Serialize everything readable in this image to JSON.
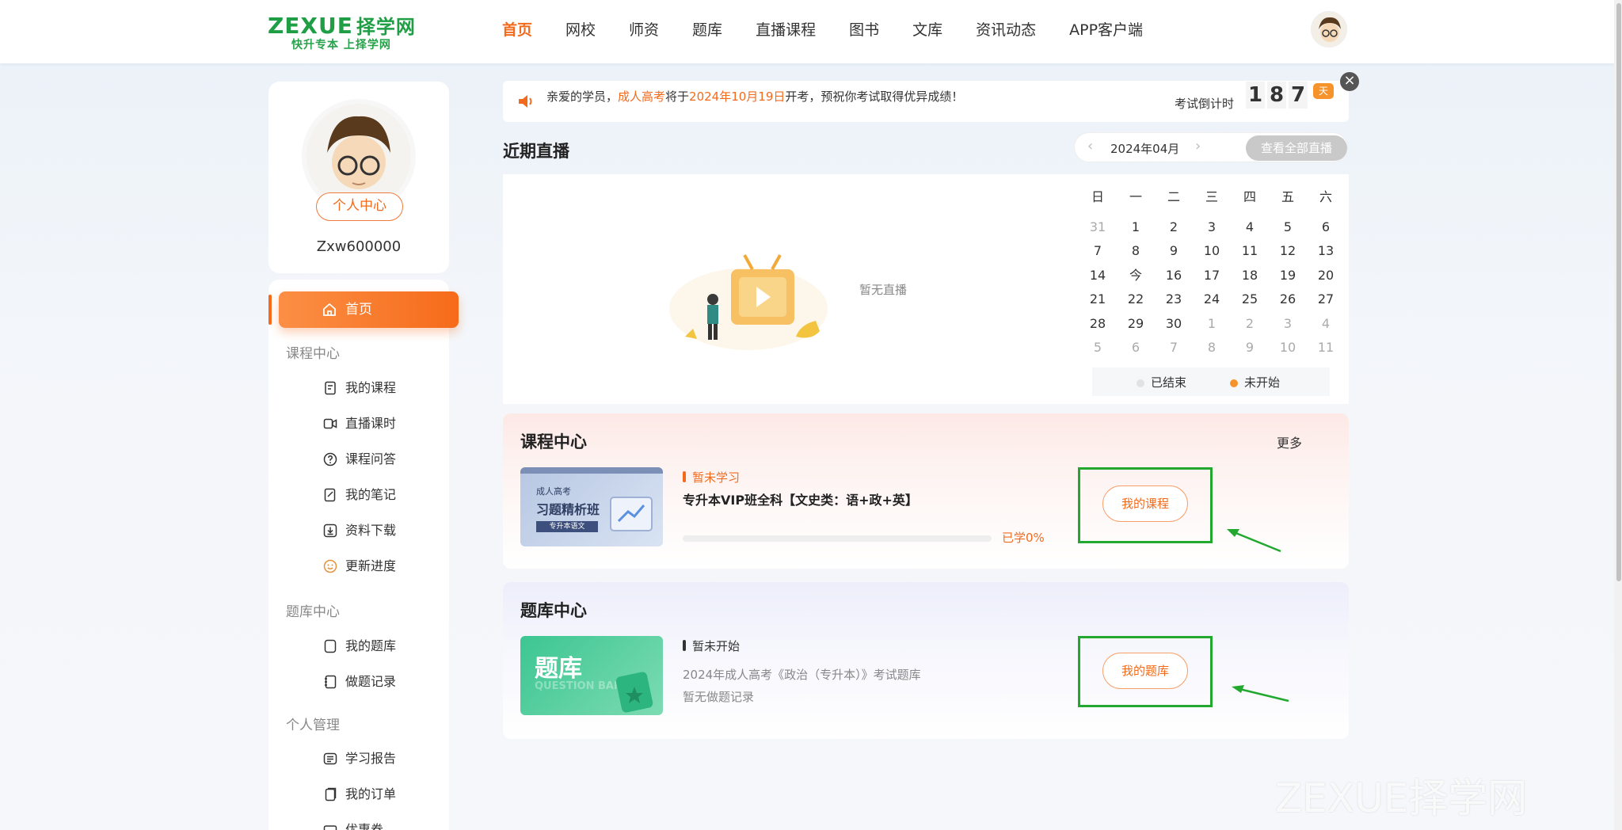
{
  "logo": {
    "brand": "ZEXUE",
    "brand_cn": "择学网",
    "slogan": "快升专本 上择学网"
  },
  "nav": [
    {
      "label": "首页",
      "active": true
    },
    {
      "label": "网校"
    },
    {
      "label": "师资"
    },
    {
      "label": "题库"
    },
    {
      "label": "直播课程"
    },
    {
      "label": "图书"
    },
    {
      "label": "文库"
    },
    {
      "label": "资讯动态"
    },
    {
      "label": "APP客户端"
    }
  ],
  "profile": {
    "center_label": "个人中心",
    "username": "Zxw600000"
  },
  "sidebar": {
    "home_label": "首页",
    "sections": [
      {
        "title": "课程中心",
        "items": [
          "我的课程",
          "直播课时",
          "课程问答",
          "我的笔记",
          "资料下载",
          "更新进度"
        ]
      },
      {
        "title": "题库中心",
        "items": [
          "我的题库",
          "做题记录"
        ]
      },
      {
        "title": "个人管理",
        "items": [
          "学习报告",
          "我的订单",
          "优惠券"
        ]
      }
    ]
  },
  "notice": {
    "prefix": "亲爱的学员，",
    "exam": "成人高考",
    "mid": "将于",
    "date": "2024年10月19日",
    "suffix": "开考，预祝你考试取得优异成绩！",
    "countdown_label": "考试倒计时",
    "digits": [
      "1",
      "8",
      "7"
    ],
    "day_unit": "天"
  },
  "live": {
    "title": "近期直播",
    "month": "2024年04月",
    "view_all": "查看全部直播",
    "empty_text": "暂无直播",
    "weekdays": [
      "日",
      "一",
      "二",
      "三",
      "四",
      "五",
      "六"
    ],
    "weeks": [
      [
        "31",
        "1",
        "2",
        "3",
        "4",
        "5",
        "6"
      ],
      [
        "7",
        "8",
        "9",
        "10",
        "11",
        "12",
        "13"
      ],
      [
        "14",
        "今",
        "16",
        "17",
        "18",
        "19",
        "20"
      ],
      [
        "21",
        "22",
        "23",
        "24",
        "25",
        "26",
        "27"
      ],
      [
        "28",
        "29",
        "30",
        "1",
        "2",
        "3",
        "4"
      ],
      [
        "5",
        "6",
        "7",
        "8",
        "9",
        "10",
        "11"
      ]
    ],
    "legend_ended": "已结束",
    "legend_not_started": "未开始"
  },
  "course_center": {
    "title": "课程中心",
    "more": "更多",
    "status": "暂未学习",
    "course_title": "专升本VIP班全科【文史类：语+政+英】",
    "thumb_small": "成人高考",
    "thumb_big": "习题精析班",
    "thumb_tag": "专升本语文",
    "progress": 0,
    "progress_text": "已学0%",
    "button": "我的课程"
  },
  "question_center": {
    "title": "题库中心",
    "status": "暂未开始",
    "bank_title": "2024年成人高考《政治（专升本）》考试题库",
    "record": "暂无做题记录",
    "thumb_big": "题库",
    "thumb_sub": "QUESTION BANK",
    "button": "我的题库"
  },
  "watermark": "ZEXUE择学网",
  "colors": {
    "accent": "#f26b1d",
    "highlight_box": "#22a82f"
  }
}
